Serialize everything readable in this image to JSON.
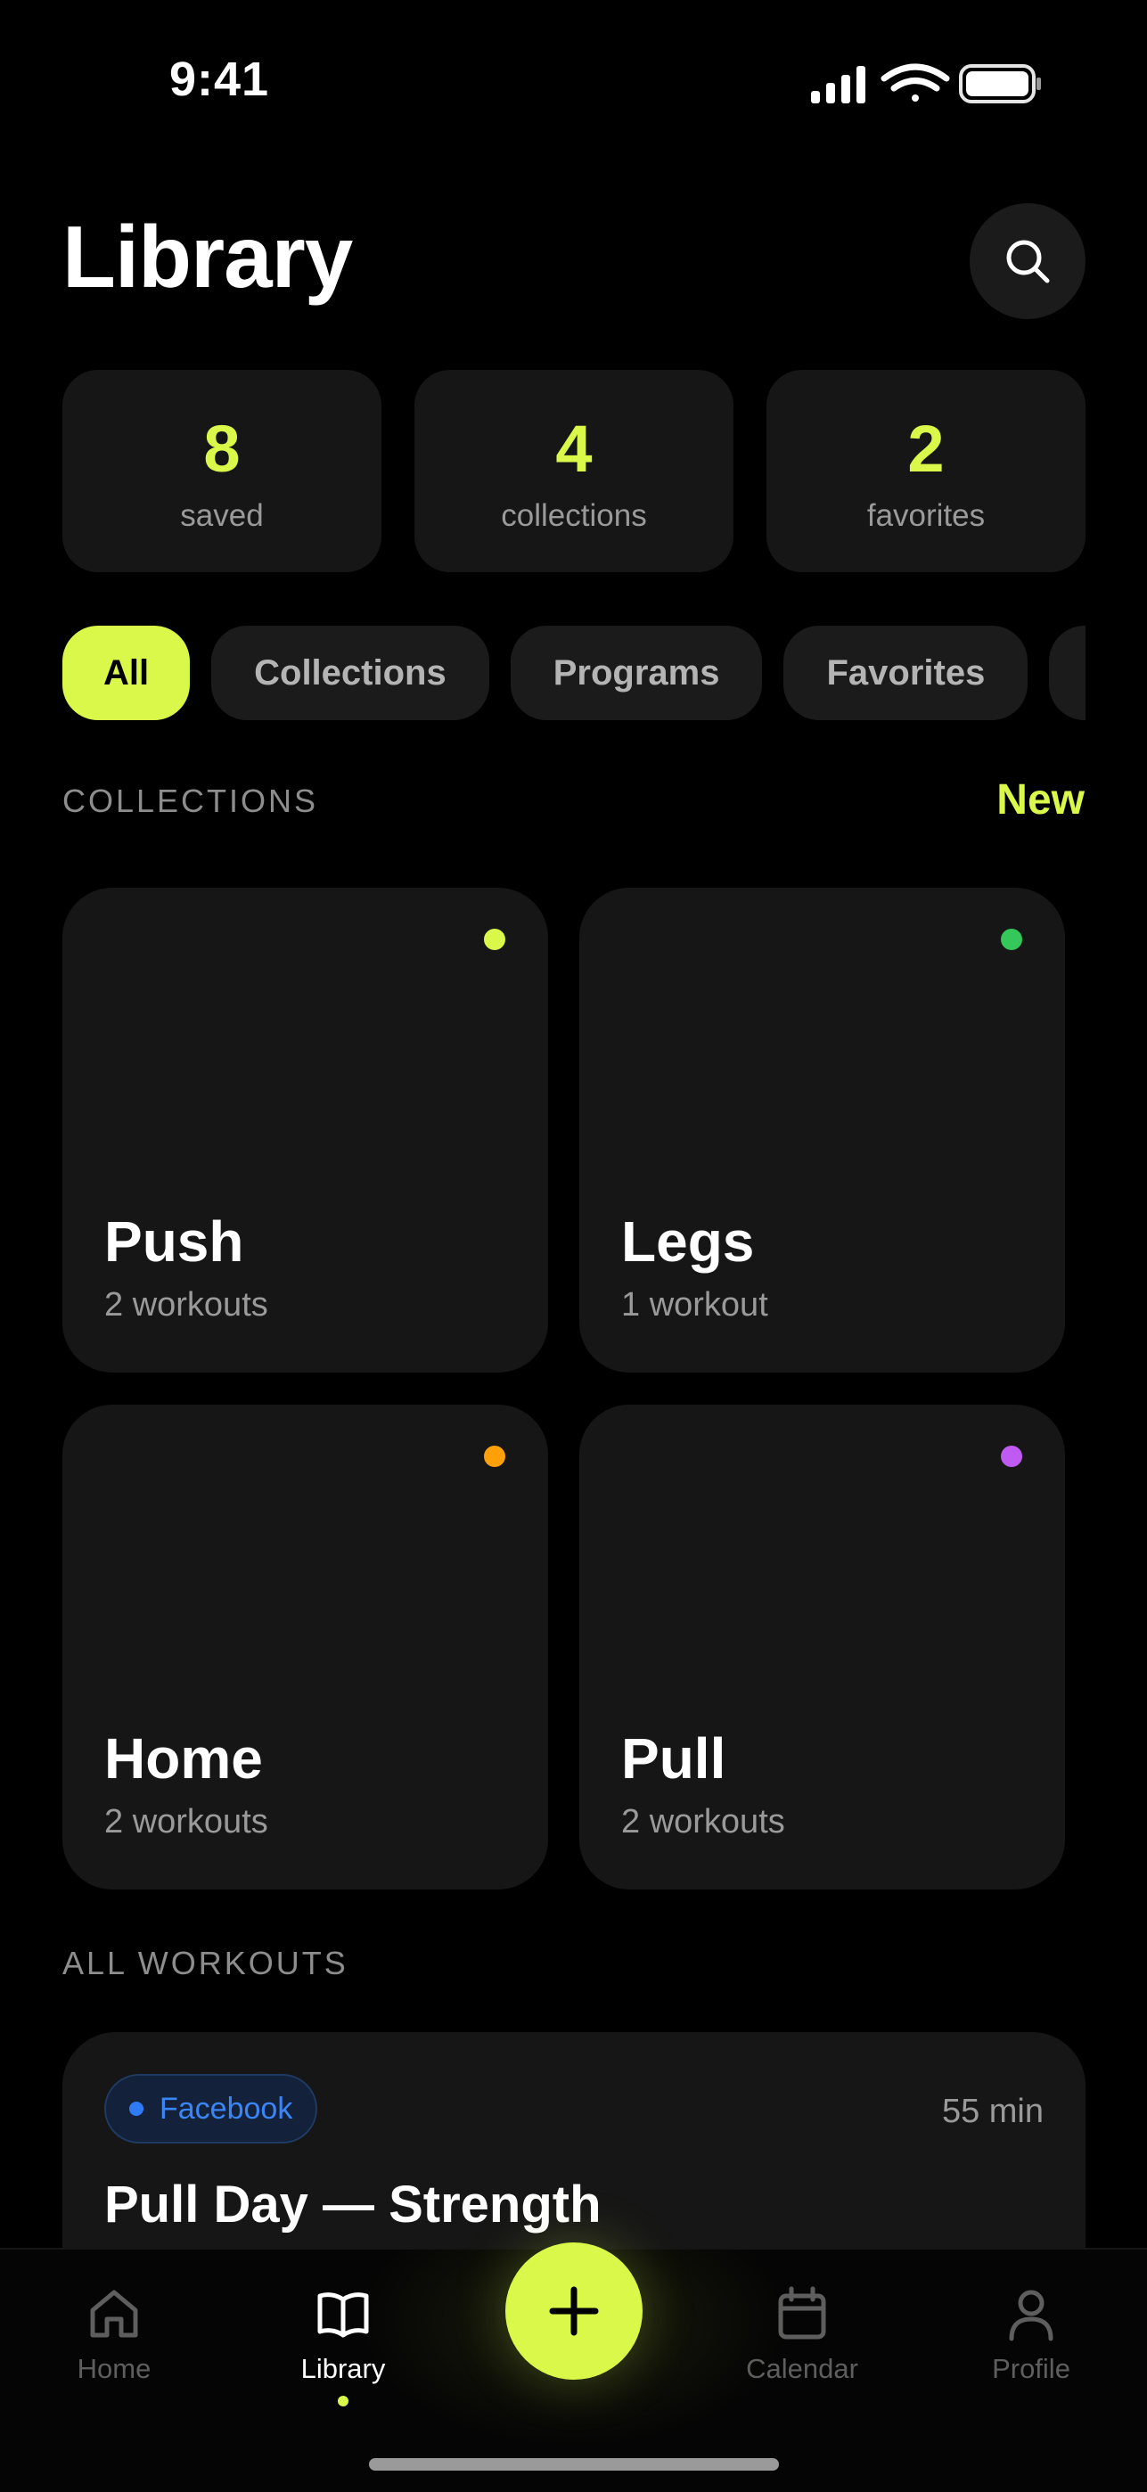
{
  "status_bar": {
    "time": "9:41"
  },
  "header": {
    "title": "Library"
  },
  "stats": [
    {
      "value": "8",
      "label": "saved"
    },
    {
      "value": "4",
      "label": "collections"
    },
    {
      "value": "2",
      "label": "favorites"
    }
  ],
  "filters": [
    {
      "label": "All",
      "active": true
    },
    {
      "label": "Collections",
      "active": false
    },
    {
      "label": "Programs",
      "active": false
    },
    {
      "label": "Favorites",
      "active": false
    },
    {
      "label": "",
      "active": false
    }
  ],
  "collections_section": {
    "label": "COLLECTIONS",
    "new_label": "New"
  },
  "collections": [
    {
      "name": "Push",
      "count": "2 workouts",
      "color": "#d9f84a"
    },
    {
      "name": "Legs",
      "count": "1 workout",
      "color": "#34c759"
    },
    {
      "name": "Home",
      "count": "2 workouts",
      "color": "#ff9f0a"
    },
    {
      "name": "Pull",
      "count": "2 workouts",
      "color": "#bf5af2"
    }
  ],
  "workouts_section": {
    "label": "ALL WORKOUTS"
  },
  "workouts": [
    {
      "source": "Facebook",
      "duration": "55 min",
      "title": "Pull Day — Strength"
    }
  ],
  "tabbar": {
    "tabs": [
      {
        "label": "Home",
        "icon": "home-icon"
      },
      {
        "label": "Library",
        "icon": "book-icon"
      },
      {
        "label": "Calendar",
        "icon": "calendar-icon"
      },
      {
        "label": "Profile",
        "icon": "profile-icon"
      }
    ],
    "active": "Library",
    "accent": "#d9f84a"
  }
}
